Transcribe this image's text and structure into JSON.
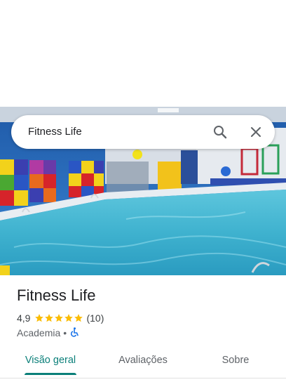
{
  "search": {
    "query": "Fitness Life"
  },
  "place": {
    "name": "Fitness Life",
    "rating": "4,9",
    "stars": 5,
    "review_count": "(10)",
    "category": "Academia",
    "separator": "•",
    "accessibility_icon": "wheelchair-icon"
  },
  "tabs": [
    {
      "label": "Visão geral",
      "active": true
    },
    {
      "label": "Avaliações",
      "active": false
    },
    {
      "label": "Sobre",
      "active": false
    }
  ],
  "colors": {
    "accent": "#0b7f79",
    "star": "#fbbc04",
    "accessibility": "#1a73e8"
  },
  "icons": [
    "search-icon",
    "close-icon",
    "star-icon",
    "wheelchair-icon"
  ]
}
